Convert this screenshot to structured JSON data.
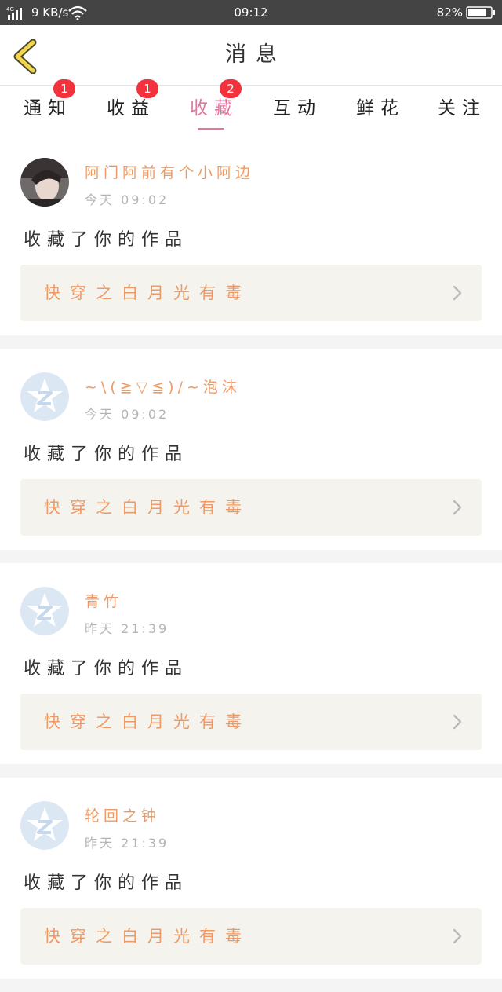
{
  "status_bar": {
    "network_speed": "9 KB/s",
    "time": "09:12",
    "battery": "82%",
    "battery_level": 0.82
  },
  "header": {
    "title": "消息"
  },
  "tabs": [
    {
      "label": "通知",
      "badge": "1"
    },
    {
      "label": "收益",
      "badge": "1"
    },
    {
      "label": "收藏",
      "badge": "2"
    },
    {
      "label": "互动",
      "badge": ""
    },
    {
      "label": "鲜花",
      "badge": ""
    },
    {
      "label": "关注",
      "badge": ""
    }
  ],
  "active_tab": "收藏",
  "messages": [
    {
      "user": "阿门阿前有个小阿边",
      "time": "今天 09:02",
      "action": "收藏了你的作品",
      "work": "快穿之白月光有毒",
      "avatar": "photo"
    },
    {
      "user": "~\\(≧▽≦)/~泡沫",
      "time": "今天 09:02",
      "action": "收藏了你的作品",
      "work": "快穿之白月光有毒",
      "avatar": "default"
    },
    {
      "user": "青竹",
      "time": "昨天 21:39",
      "action": "收藏了你的作品",
      "work": "快穿之白月光有毒",
      "avatar": "default"
    },
    {
      "user": "轮回之钟",
      "time": "昨天 21:39",
      "action": "收藏了你的作品",
      "work": "快穿之白月光有毒",
      "avatar": "default"
    }
  ],
  "colors": {
    "accent": "#e2769f",
    "username": "#ee9a66",
    "badge": "#f2333d",
    "back_arrow": "#f4d64e"
  }
}
